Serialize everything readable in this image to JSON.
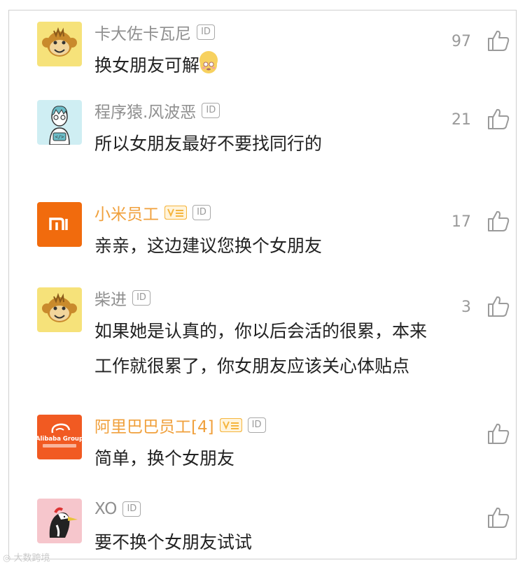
{
  "comments": [
    {
      "name": "卡大佐卡瓦尼",
      "id_badge": "ID",
      "text": "换女朋友可解",
      "likes": "97",
      "avatar_icon": "monkey-avatar-icon",
      "staff": false
    },
    {
      "name": "程序猿.风波恶",
      "id_badge": "ID",
      "text": "所以女朋友最好不要找同行的",
      "likes": "21",
      "avatar_icon": "programmer-avatar-icon",
      "staff": false
    },
    {
      "name": "小米员工",
      "id_badge": "ID",
      "text": "亲亲，这边建议您换个女朋友",
      "likes": "17",
      "avatar_icon": "xiaomi-logo-icon",
      "staff": true
    },
    {
      "name": "柴进",
      "id_badge": "ID",
      "text_line1": "如果她是认真的，你以后会活的很累，本来",
      "text_line2": "工作就很累了，你女朋友应该关心体贴点",
      "likes": "3",
      "avatar_icon": "monkey-avatar-icon",
      "staff": false
    },
    {
      "name": "阿里巴巴员工[4]",
      "id_badge": "ID",
      "text": "简单，换个女朋友",
      "likes": "",
      "avatar_icon": "alibaba-logo-icon",
      "avatar_text": "Alibaba Group",
      "staff": true
    },
    {
      "name": "XO",
      "id_badge": "ID",
      "text": "要不换个女朋友试试",
      "likes": "",
      "avatar_icon": "woodpecker-avatar-icon",
      "staff": false
    }
  ],
  "colors": {
    "name": "#8f8f8f",
    "staff_name": "#f0a03c",
    "badge": "#f5b53d",
    "xiaomi": "#f16b0d",
    "alibaba": "#f15a22"
  },
  "watermark": "大数跨境"
}
